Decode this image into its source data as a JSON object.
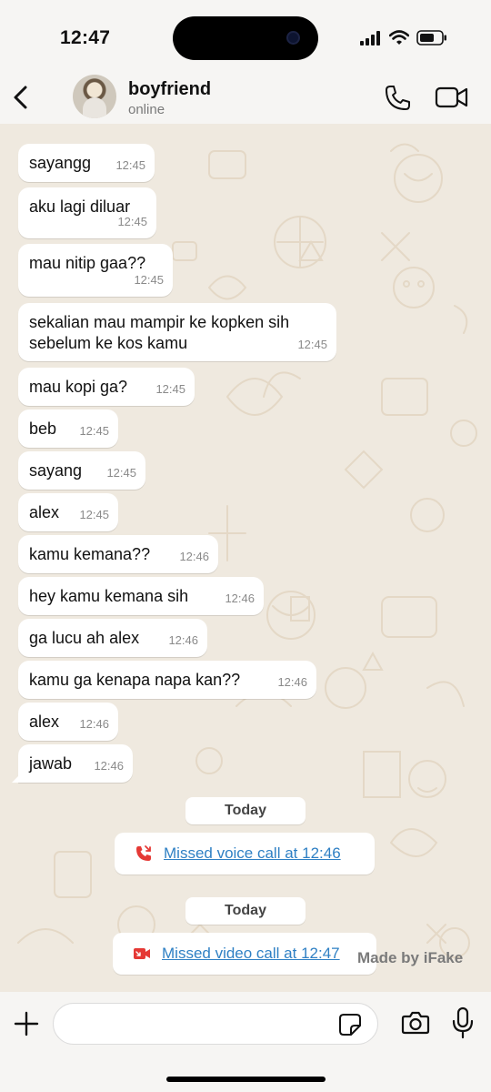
{
  "status_bar": {
    "time": "12:47"
  },
  "header": {
    "contact_name": "boyfriend",
    "contact_status": "online"
  },
  "messages": [
    {
      "text": "sayangg",
      "time": "12:45"
    },
    {
      "text": "aku lagi diluar",
      "time": "12:45"
    },
    {
      "text": "mau nitip gaa??",
      "time": "12:45"
    },
    {
      "text": "sekalian mau mampir ke kopken sih sebelum ke kos kamu",
      "time": "12:45"
    },
    {
      "text": "mau kopi ga?",
      "time": "12:45"
    },
    {
      "text": "beb",
      "time": "12:45"
    },
    {
      "text": "sayang",
      "time": "12:45"
    },
    {
      "text": "alex",
      "time": "12:45"
    },
    {
      "text": "kamu kemana??",
      "time": "12:46"
    },
    {
      "text": "hey kamu kemana sih",
      "time": "12:46"
    },
    {
      "text": "ga lucu ah alex",
      "time": "12:46"
    },
    {
      "text": "kamu ga kenapa napa kan??",
      "time": "12:46"
    },
    {
      "text": "alex",
      "time": "12:46"
    },
    {
      "text": "jawab",
      "time": "12:46"
    }
  ],
  "date_chips": [
    "Today",
    "Today"
  ],
  "calls": [
    {
      "label": "Missed voice call at 12:46",
      "icon": "missed-voice-call-icon",
      "color": "#e53935"
    },
    {
      "label": "Missed video call at 12:47",
      "icon": "missed-video-call-icon",
      "color": "#e53935"
    }
  ],
  "watermark": "Made by iFake",
  "input": {
    "placeholder": ""
  },
  "colors": {
    "link": "#2f80c4",
    "chat_background": "#efe9df",
    "bubble": "#ffffff"
  }
}
